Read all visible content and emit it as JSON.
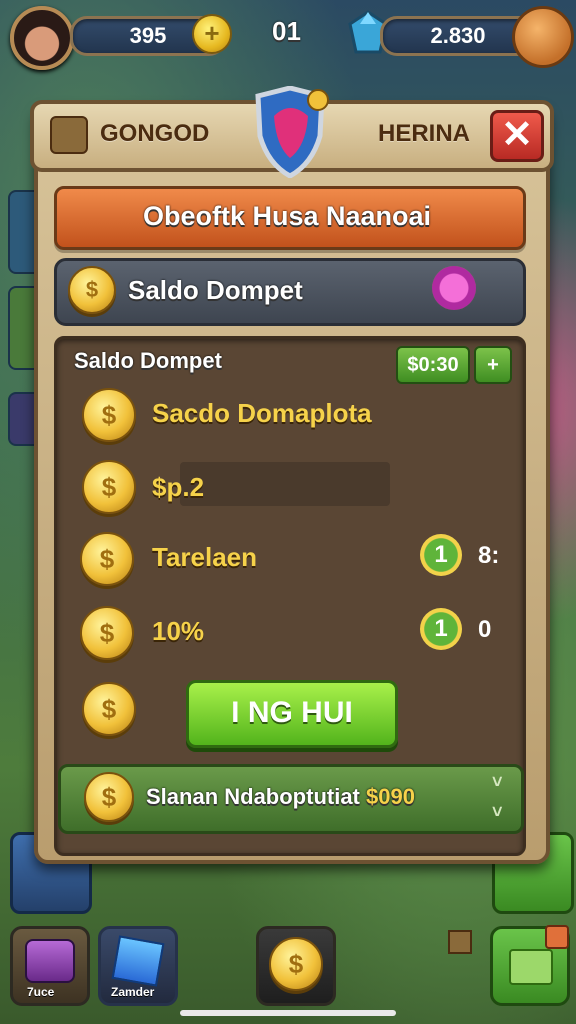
{
  "hud": {
    "coins": "395",
    "center_value": "01",
    "gems": "2.830",
    "plus_label": "+"
  },
  "dialog": {
    "tab_left": "GONGOD",
    "tab_right": "HERINA",
    "close_label": "✕",
    "banner": "Obeoftk Husa Naanoai",
    "wallet_label": "Saldo Dompet",
    "section_title": "Saldo Dompet",
    "price_badge": "$0:30",
    "price_plus": "+",
    "rows": [
      {
        "label": "Sacdo Domaplota"
      },
      {
        "label": "$p.2"
      },
      {
        "label": "Tarelaen",
        "ring": "1",
        "value": "8:"
      },
      {
        "label": "10%",
        "ring": "1",
        "value": "0"
      }
    ],
    "action_button": "I NG HUI",
    "footer_label": "Slanan Ndaboptutiat",
    "footer_price": "$090"
  },
  "bottom_nav": [
    {
      "label": "7uce"
    },
    {
      "label": "Zamder"
    },
    {
      "label": ""
    },
    {
      "label": ""
    }
  ],
  "colors": {
    "banner": "#e0703a",
    "button": "#7fd232",
    "coin": "#f1c13a",
    "close": "#d94236"
  }
}
